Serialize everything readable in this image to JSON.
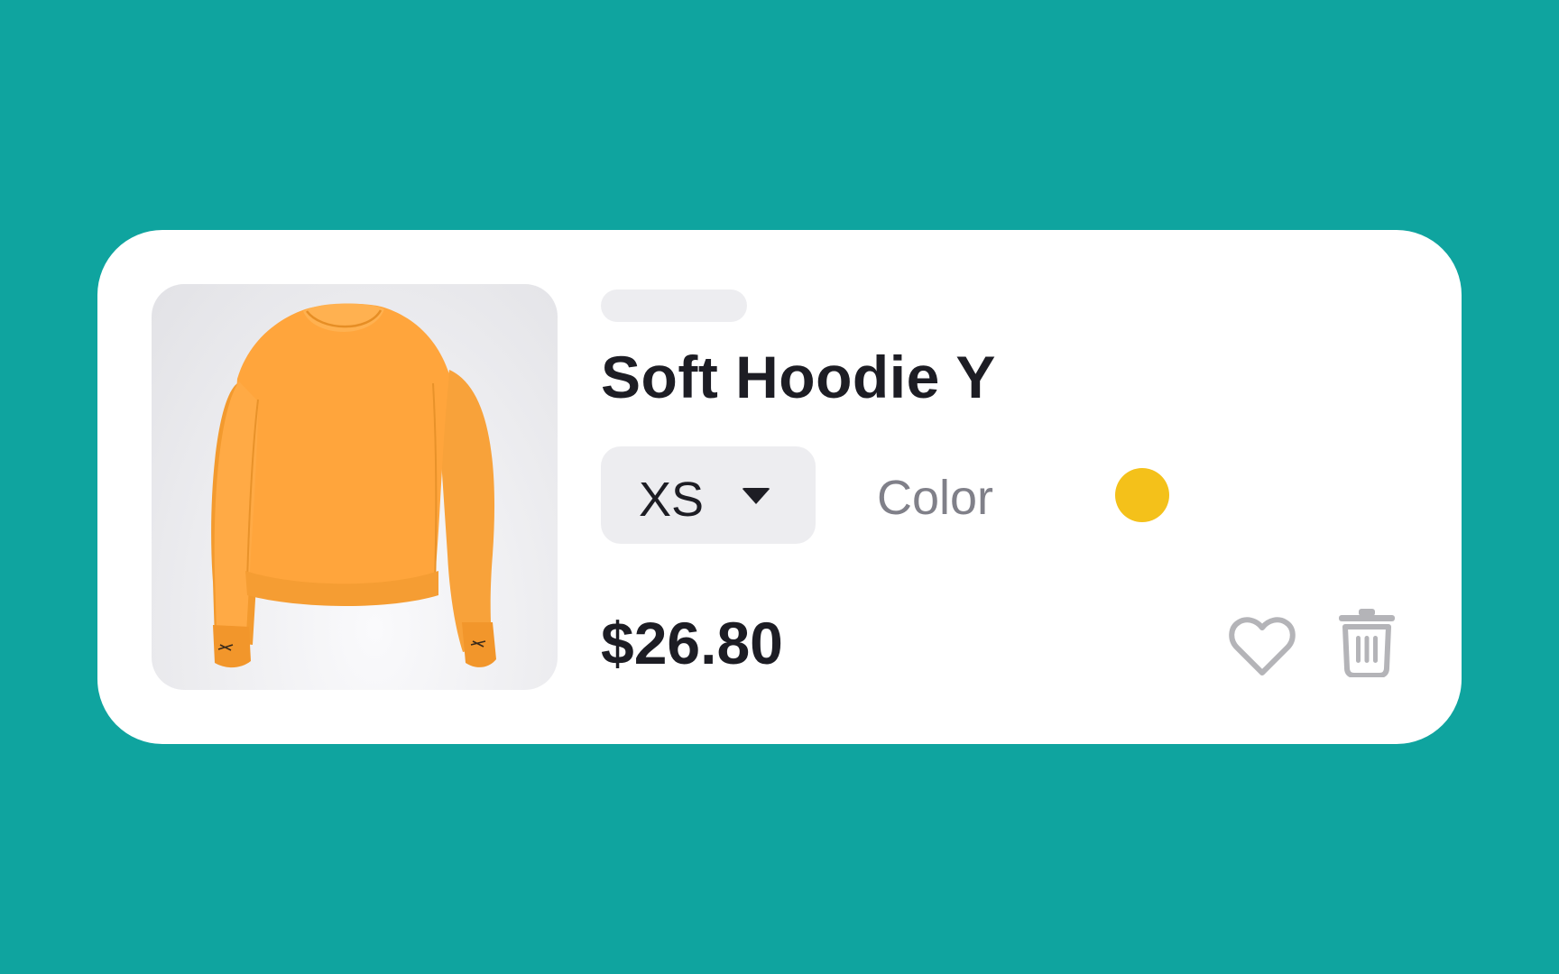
{
  "product": {
    "name": "Soft Hoodie Y",
    "image_alt": "Orange sweatshirt",
    "size": "XS",
    "color_label": "Color",
    "price": "$26.80"
  },
  "colors": {
    "background": "#0FA49F",
    "card": "#FFFFFF",
    "selected_color": "#F4C11A",
    "product_orange": "#FFA53C"
  },
  "icons": {
    "size_dropdown": "caret-down-icon",
    "favorite": "heart-icon",
    "remove": "trash-icon"
  }
}
